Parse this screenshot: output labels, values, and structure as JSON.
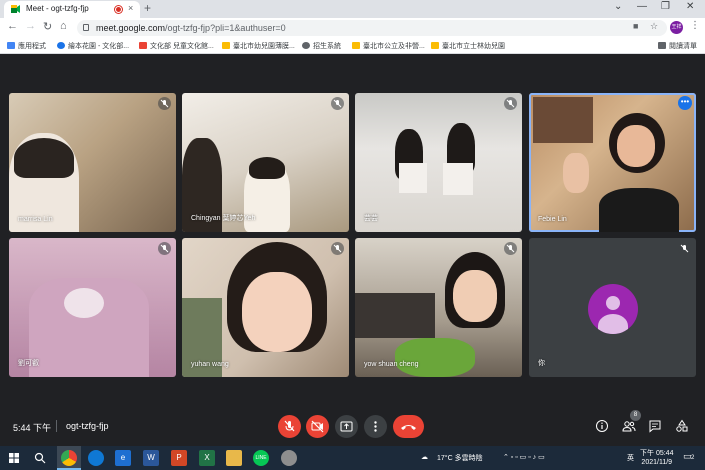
{
  "browser": {
    "tab_title": "Meet - ogt-tzfg-fjp",
    "new_tab": "+",
    "close": "×",
    "window_controls": {
      "minimize": "—",
      "restore": "❐",
      "close": "✕",
      "chevron": "⌄"
    },
    "url_host": "meet.google.com",
    "url_path": "/ogt-tzfg-fjp?pli=1&authuser=0",
    "profile_initials": "王祥",
    "reading_list": "閱讀清單"
  },
  "bookmarks": [
    {
      "label": "應用程式",
      "color": "#4285f4"
    },
    {
      "label": "繪本花園 - 文化部...",
      "color": "#1a73e8"
    },
    {
      "label": "文化部 兒童文化館...",
      "color": "#ea4335"
    },
    {
      "label": "臺北市幼兒園薄膜...",
      "color": "#fbbc04"
    },
    {
      "label": "招生系統",
      "color": "#5f6368"
    },
    {
      "label": "臺北市公立及非營...",
      "color": "#fbbc04"
    },
    {
      "label": "臺北市立士林幼兒園",
      "color": "#fbbc04"
    }
  ],
  "participants": [
    {
      "name": "marrisa Lin",
      "muted": true,
      "speaking": false
    },
    {
      "name": "Chingyan 葉婷芯Yeh",
      "muted": true,
      "speaking": false
    },
    {
      "name": "芸芸",
      "muted": true,
      "speaking": false
    },
    {
      "name": "Febie Lin",
      "muted": false,
      "speaking": true
    },
    {
      "name": "劉可叡",
      "muted": true,
      "speaking": false
    },
    {
      "name": "yuhan wang",
      "muted": true,
      "speaking": false
    },
    {
      "name": "yow shuan cheng",
      "muted": true,
      "speaking": false
    },
    {
      "name": "你",
      "muted": true,
      "speaking": false
    }
  ],
  "meeting": {
    "time": "5:44 下午",
    "code": "ogt-tzfg-fjp",
    "people_count": "8"
  },
  "taskbar": {
    "weather": "17°C 多雲時陰",
    "ime": "英",
    "time": "下午 05:44",
    "date": "2021/11/9",
    "notification_count": "2"
  }
}
